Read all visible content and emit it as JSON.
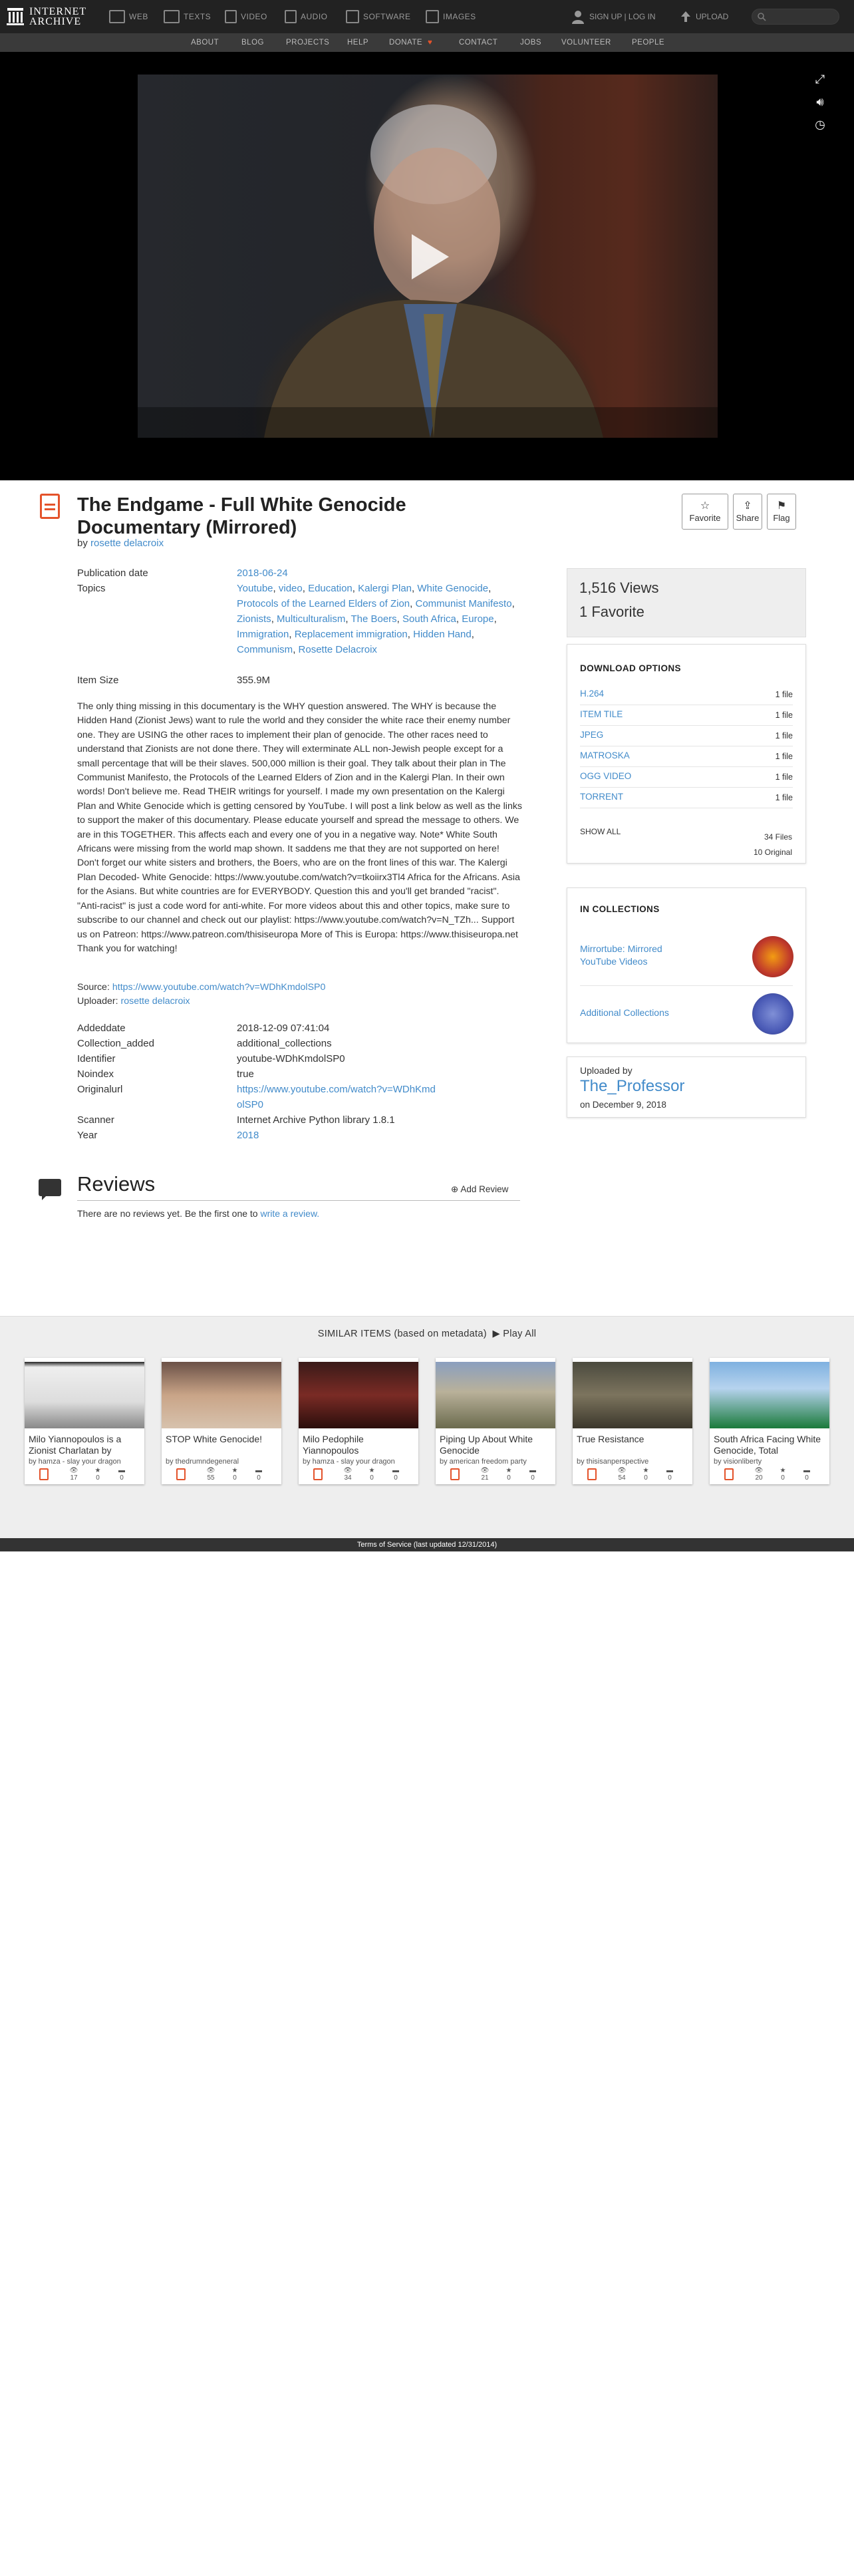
{
  "topnav": {
    "logo_line1": "INTERNET",
    "logo_line2": "ARCHIVE",
    "items": [
      {
        "label": "WEB",
        "icon": "web-icon"
      },
      {
        "label": "TEXTS",
        "icon": "book-icon"
      },
      {
        "label": "VIDEO",
        "icon": "film-icon"
      },
      {
        "label": "AUDIO",
        "icon": "speaker-icon"
      },
      {
        "label": "SOFTWARE",
        "icon": "floppy-icon"
      },
      {
        "label": "IMAGES",
        "icon": "image-icon"
      }
    ],
    "signup": "SIGN UP | LOG IN",
    "upload": "UPLOAD"
  },
  "subnav": [
    "ABOUT",
    "BLOG",
    "PROJECTS",
    "HELP",
    "DONATE",
    "CONTACT",
    "JOBS",
    "VOLUNTEER",
    "PEOPLE"
  ],
  "item": {
    "title": "The Endgame - Full White Genocide Documentary (Mirrored)",
    "by_label": "by",
    "creator": "rosette delacroix",
    "actions": [
      "Favorite",
      "Share",
      "Flag"
    ],
    "metadata": {
      "publication_date_label": "Publication date",
      "publication_date": "2018-06-24",
      "topics_label": "Topics",
      "topics": [
        "Youtube",
        "video",
        "Education",
        "Kalergi Plan",
        "White Genocide",
        "Protocols of the Learned Elders of Zion",
        "Communist Manifesto",
        "Zionists",
        "Multiculturalism",
        "The Boers",
        "South Africa",
        "Europe",
        "Immigration",
        "Replacement immigration",
        "Hidden Hand",
        "Communism",
        "Rosette Delacroix"
      ],
      "item_size_label": "Item Size",
      "item_size": "355.9M"
    },
    "description": "The only thing missing in this documentary is the WHY question answered. The WHY is because the Hidden Hand (Zionist Jews) want to rule the world and they consider the white race their enemy number one. They are USING the other races to implement their plan of genocide. The other races need to understand that Zionists are not done there. They will exterminate ALL non-Jewish people except for a small percentage that will be their slaves. 500,000 million is their goal. They talk about their plan in The Communist Manifesto, the Protocols of the Learned Elders of Zion and in the Kalergi Plan. In their own words! Don't believe me. Read THEIR writings for yourself. I made my own presentation on the Kalergi Plan and White Genocide which is getting censored by YouTube. I will post a link below as well as the links to support the maker of this documentary. Please educate yourself and spread the message to others. We are in this TOGETHER. This affects each and every one of you in a negative way. Note* White South Africans were missing from the world map shown. It saddens me that they are not supported on here! Don't forget our white sisters and brothers, the Boers, who are on the front lines of this war. The Kalergi Plan Decoded- White Genocide: https://www.youtube.com/watch?v=tkoiirx3Tl4 Africa for the Africans. Asia for the Asians. But white countries are for EVERYBODY. Question this and you'll get branded \"racist\". \"Anti-racist\" is just a code word for anti-white. For more videos about this and other topics, make sure to subscribe to our channel and check out our playlist: https://www.youtube.com/watch?v=N_TZh... Support us on Patreon: https://www.patreon.com/thisiseuropa More of This is Europa: https://www.thisiseuropa.net Thank you for watching!",
    "source_label": "Source:",
    "source_url": "https://www.youtube.com/watch?v=WDhKmdolSP0",
    "uploader_label": "Uploader:",
    "uploader": "rosette delacroix",
    "extra": [
      {
        "k": "Addeddate",
        "v": "2018-12-09 07:41:04"
      },
      {
        "k": "Collection_added",
        "v": "additional_collections"
      },
      {
        "k": "Identifier",
        "v": "youtube-WDhKmdolSP0"
      },
      {
        "k": "Noindex",
        "v": "true"
      },
      {
        "k": "Originalurl",
        "v": "https://www.youtube.com/watch?v=WDhKmdolSP0"
      },
      {
        "k": "Scanner",
        "v": "Internet Archive Python library 1.8.1"
      },
      {
        "k": "Year",
        "v": "2018"
      }
    ]
  },
  "sidebar": {
    "views": "1,516 Views",
    "favorites": "1 Favorite",
    "download_heading": "DOWNLOAD OPTIONS",
    "downloads": [
      {
        "format": "H.264",
        "count": "1 file"
      },
      {
        "format": "ITEM TILE",
        "count": "1 file"
      },
      {
        "format": "JPEG",
        "count": "1 file"
      },
      {
        "format": "MATROSKA",
        "count": "1 file"
      },
      {
        "format": "OGG VIDEO",
        "count": "1 file"
      },
      {
        "format": "TORRENT",
        "count": "1 file"
      }
    ],
    "show_all": "SHOW ALL",
    "files_total": "34 Files",
    "files_original": "10 Original",
    "collections_heading": "IN COLLECTIONS",
    "collections": [
      "Mirrortube: Mirrored YouTube Videos",
      "Additional Collections"
    ],
    "uploaded_by_label": "Uploaded by",
    "uploaded_by": "The_Professor",
    "uploaded_on": "on December 9, 2018"
  },
  "reviews": {
    "heading": "Reviews",
    "add_label": "Add Review",
    "empty_text": "There are no reviews yet. Be the first one to",
    "empty_link": "write a review."
  },
  "similar": {
    "heading": "SIMILAR ITEMS (based on metadata)",
    "play_all": "Play All",
    "items": [
      {
        "title": "Milo Yiannopoulos is a Zionist Charlatan by",
        "by": "by hamza - slay your dragon",
        "views": "17",
        "favs": "0",
        "reviews": "0"
      },
      {
        "title": "STOP White Genocide!",
        "by": "by thedrumndegeneral",
        "views": "55",
        "favs": "0",
        "reviews": "0"
      },
      {
        "title": "Milo Pedophile Yiannopoulos",
        "by": "by hamza - slay your dragon",
        "views": "34",
        "favs": "0",
        "reviews": "0"
      },
      {
        "title": "Piping Up About White Genocide",
        "by": "by american freedom party",
        "views": "21",
        "favs": "0",
        "reviews": "0"
      },
      {
        "title": "True Resistance",
        "by": "by thisisanperspective",
        "views": "54",
        "favs": "0",
        "reviews": "0"
      },
      {
        "title": "South Africa Facing White Genocide, Total",
        "by": "by visionliberty",
        "views": "20",
        "favs": "0",
        "reviews": "0"
      }
    ]
  },
  "footer": "Terms of Service (last updated 12/31/2014)"
}
